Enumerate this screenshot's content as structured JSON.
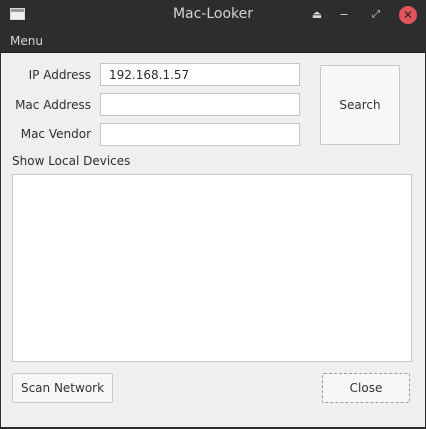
{
  "window": {
    "title": "Mac-Looker",
    "controls": {
      "eject": "⏏",
      "minimize": "−",
      "maximize": "⤢",
      "close": "✕"
    }
  },
  "menubar": {
    "items": [
      "Menu"
    ]
  },
  "form": {
    "ip_label": "IP Address",
    "ip_value": "192.168.1.57",
    "mac_label": "Mac Address",
    "mac_value": "",
    "vendor_label": "Mac Vendor",
    "vendor_value": "",
    "search_label": "Search"
  },
  "devices": {
    "label": "Show Local Devices",
    "items": []
  },
  "footer": {
    "scan_label": "Scan Network",
    "close_label": "Close"
  }
}
